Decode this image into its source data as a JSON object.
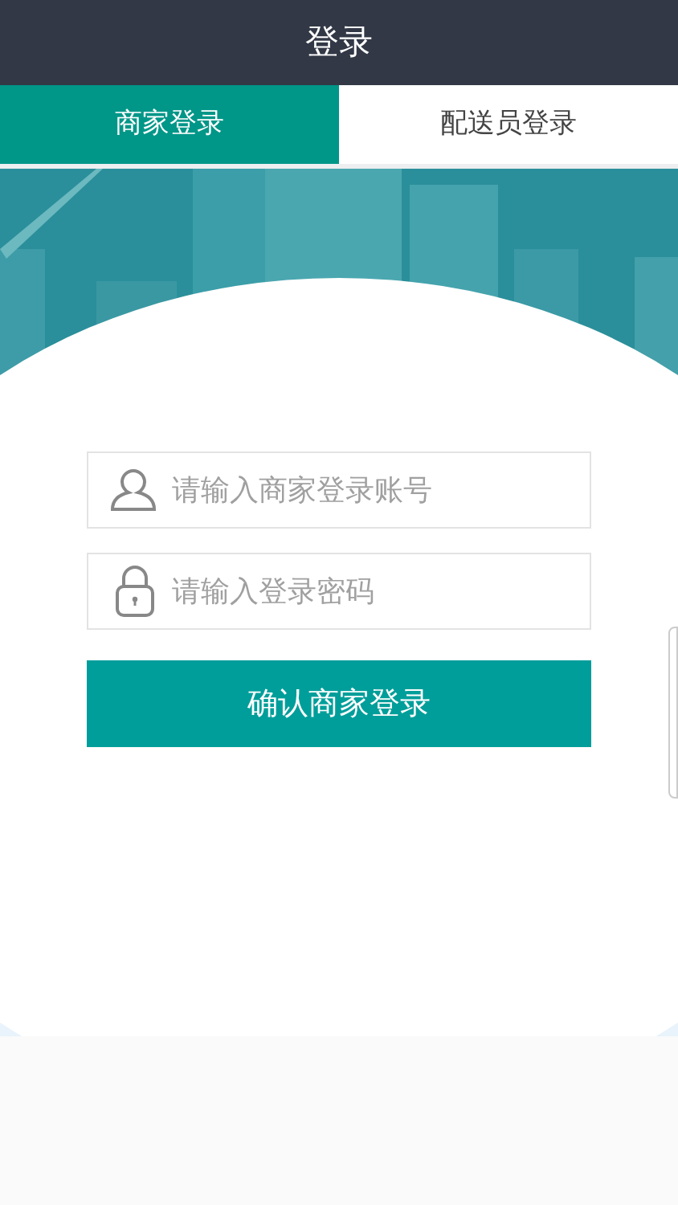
{
  "header": {
    "title": "登录"
  },
  "tabs": [
    {
      "label": "商家登录",
      "selected": true
    },
    {
      "label": "配送员登录",
      "selected": false
    }
  ],
  "form": {
    "account": {
      "placeholder": "请输入商家登录账号"
    },
    "password": {
      "placeholder": "请输入登录密码"
    },
    "submit": "确认商家登录"
  }
}
